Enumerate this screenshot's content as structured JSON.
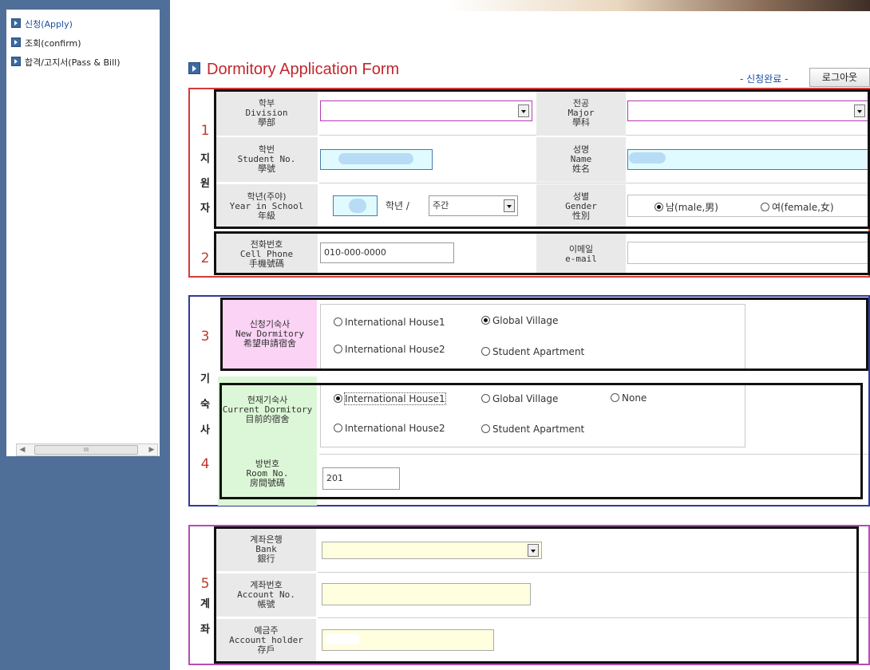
{
  "sidebar": {
    "items": [
      {
        "label": "신청(Apply)"
      },
      {
        "label": "조회(confirm)"
      },
      {
        "label": "합격/고지서(Pass & Bill)"
      }
    ],
    "scroll_thumb_grip": "III"
  },
  "header": {
    "title": "Dormitory Application Form",
    "status": "- 신청완료 -",
    "logout_label": "로그아웃"
  },
  "sections": {
    "applicant": {
      "number": "1",
      "number2": "2",
      "vertical_label": [
        "지",
        "원",
        "자"
      ]
    },
    "dorm": {
      "number": "3",
      "number2": "4",
      "vertical_label": [
        "기",
        "숙",
        "사"
      ]
    },
    "account": {
      "number": "5",
      "vertical_label": [
        "계",
        "좌"
      ]
    }
  },
  "labels": {
    "division": [
      "학부",
      "Division",
      "學部"
    ],
    "major": [
      "전공",
      "Major",
      "學科"
    ],
    "student_no": [
      "학번",
      "Student No.",
      "學號"
    ],
    "name": [
      "성명",
      "Name",
      "姓名"
    ],
    "year": [
      "학년(주야)",
      "Year in School",
      "年級"
    ],
    "gender": [
      "성별",
      "Gender",
      "性別"
    ],
    "phone": [
      "전화번호",
      "Cell Phone",
      "手機號碼"
    ],
    "email": [
      "이메일",
      "e-mail"
    ],
    "new_dorm": [
      "신청기숙사",
      "New Dormitory",
      "希望申請宿舍"
    ],
    "current_dorm": [
      "현재기숙사",
      "Current Dormitory",
      "目前的宿舍"
    ],
    "room_no": [
      "방번호",
      "Room No.",
      "房間號碼"
    ],
    "bank": [
      "계좌은행",
      "Bank",
      "銀行"
    ],
    "account_no": [
      "계좌번호",
      "Account No.",
      "帳號"
    ],
    "account_holder": [
      "예금주",
      "Account holder",
      "存戶"
    ]
  },
  "fields": {
    "year_suffix": "학년 /",
    "day_night_value": "주간",
    "phone_value": "010-000-0000",
    "room_no_value": "201"
  },
  "gender_options": [
    {
      "label": "남(male,男)",
      "selected": true
    },
    {
      "label": "여(female,女)",
      "selected": false
    }
  ],
  "new_dorm_options": [
    {
      "label": "International House1",
      "selected": false
    },
    {
      "label": "Global Village",
      "selected": true
    },
    {
      "label": "International House2",
      "selected": false
    },
    {
      "label": "Student Apartment",
      "selected": false
    }
  ],
  "current_dorm_options": [
    {
      "label": "International House1",
      "selected": true
    },
    {
      "label": "Global Village",
      "selected": false
    },
    {
      "label": "None",
      "selected": false
    },
    {
      "label": "International House2",
      "selected": false
    },
    {
      "label": "Student Apartment",
      "selected": false
    }
  ],
  "colors": {
    "sidebar_bg": "#4f6f98",
    "title_red": "#c1272d",
    "section1_border": "#d43a3a",
    "section2_border": "#2f3a9c",
    "section3_border": "#b54db5",
    "pink_label": "#fbd3f5",
    "green_label": "#dcf7d7",
    "yellow_input": "#ffffe0"
  }
}
